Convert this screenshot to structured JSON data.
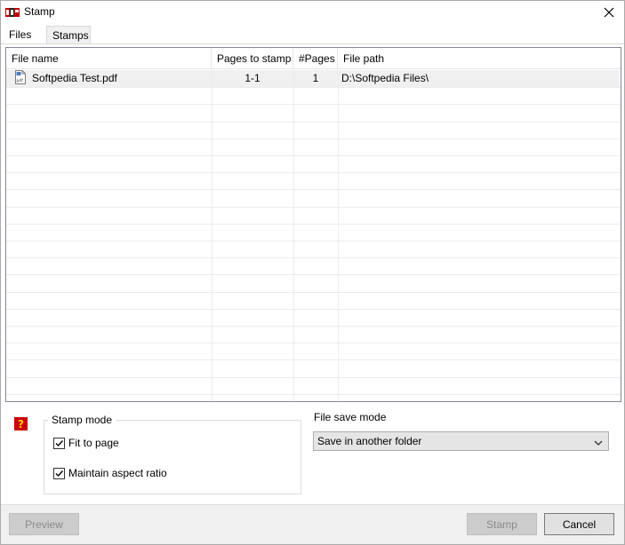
{
  "window": {
    "title": "Stamp"
  },
  "tabs": [
    {
      "label": "Files",
      "active": true
    },
    {
      "label": "Stamps",
      "active": false
    }
  ],
  "table": {
    "columns": [
      "File name",
      "Pages to stamp",
      "#Pages",
      "File path"
    ],
    "rows": [
      {
        "file_name": "Softpedia Test.pdf",
        "pages_to_stamp": "1-1",
        "num_pages": "1",
        "file_path": "D:\\Softpedia Files\\"
      }
    ]
  },
  "stamp_mode": {
    "legend": "Stamp mode",
    "fit_to_page": {
      "label": "Fit to page",
      "checked": true
    },
    "maintain_aspect": {
      "label": "Maintain aspect ratio",
      "checked": true
    }
  },
  "file_save_mode": {
    "label": "File save mode",
    "value": "Save in another folder"
  },
  "buttons": {
    "preview": "Preview",
    "stamp": "Stamp",
    "cancel": "Cancel"
  },
  "colors": {
    "help_icon_bg": "#cc0000",
    "help_icon_fg": "#ffd400",
    "disabled_text": "#8a8a8a"
  }
}
